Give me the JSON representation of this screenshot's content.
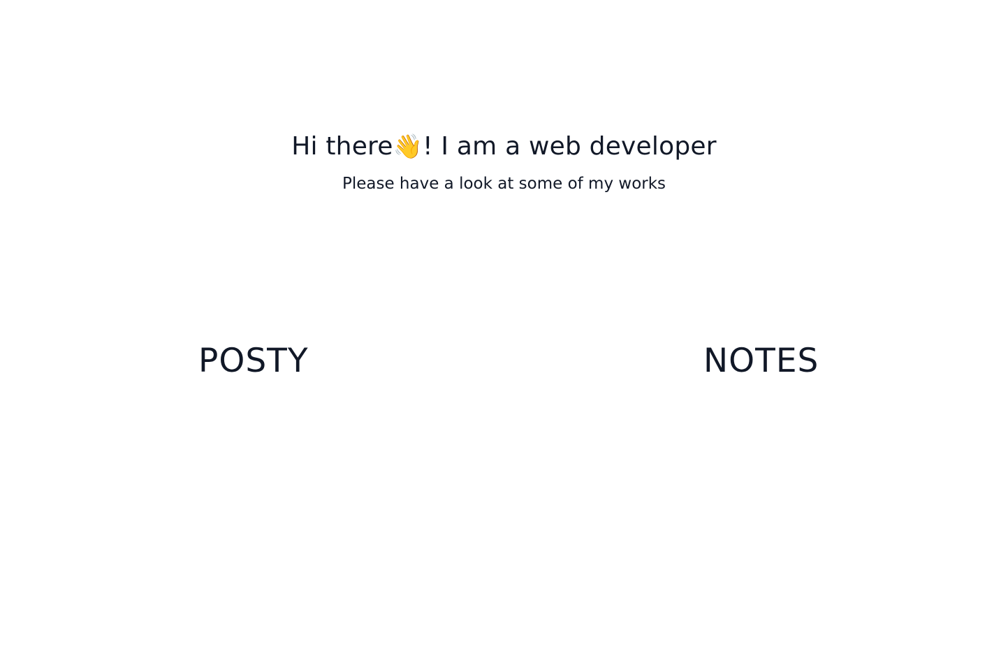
{
  "hero": {
    "title_before": "Hi there",
    "wave_emoji": "👋",
    "title_after": "! I am a web developer",
    "subtitle": "Please have a look at some of my works"
  },
  "works": [
    {
      "label": "POSTY"
    },
    {
      "label": "NOTES"
    }
  ],
  "colors": {
    "background": "#ffffff",
    "text": "#111827"
  }
}
